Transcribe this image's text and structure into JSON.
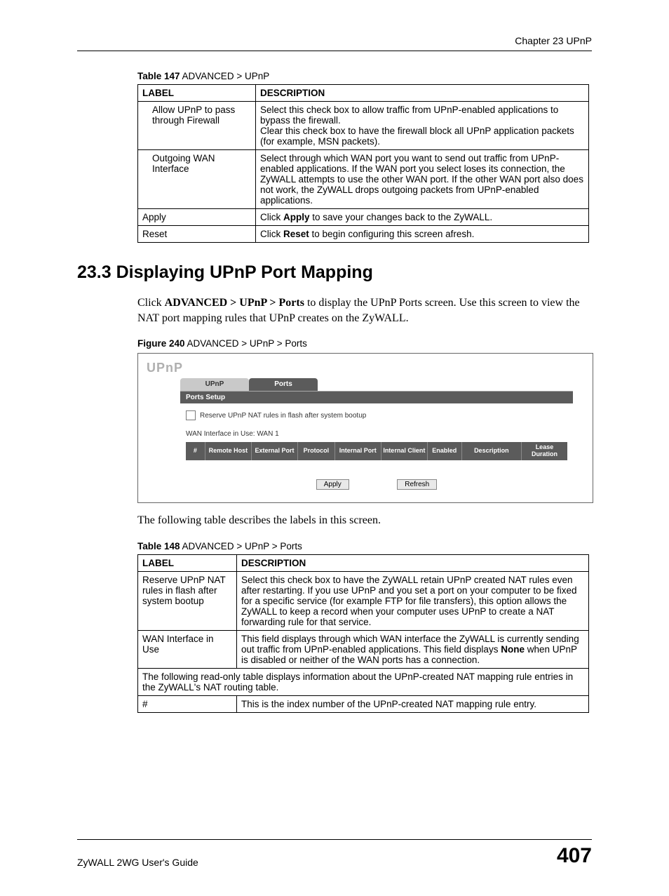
{
  "header": {
    "chapter": "Chapter 23 UPnP"
  },
  "table147": {
    "caption_bold": "Table 147",
    "caption_rest": "   ADVANCED > UPnP",
    "head_label": "LABEL",
    "head_desc": "DESCRIPTION",
    "rows": [
      {
        "label": "Allow UPnP to pass through Firewall",
        "desc": "Select this check box to allow traffic from UPnP-enabled applications to bypass the firewall.\nClear this check box to have the firewall block all UPnP application packets (for example, MSN packets).",
        "indent": true
      },
      {
        "label": "Outgoing WAN Interface",
        "desc": "Select through which WAN port you want to send out traffic from UPnP-enabled applications. If the WAN port you select loses its connection, the ZyWALL attempts to use the other WAN port. If the other WAN port also does not work, the ZyWALL drops outgoing packets from UPnP-enabled applications.",
        "indent": true
      },
      {
        "label": "Apply",
        "desc_pre": "Click ",
        "desc_bold": "Apply",
        "desc_post": " to save your changes back to the ZyWALL.",
        "indent": false
      },
      {
        "label": "Reset",
        "desc_pre": "Click ",
        "desc_bold": "Reset",
        "desc_post": " to begin configuring this screen afresh.",
        "indent": false
      }
    ]
  },
  "section": {
    "heading": "23.3  Displaying UPnP Port Mapping",
    "para1_pre": "Click ",
    "para1_bold": "ADVANCED > UPnP > Ports",
    "para1_post": " to display the UPnP Ports screen. Use this screen to view the NAT port mapping rules that UPnP creates on the ZyWALL."
  },
  "figure": {
    "caption_bold": "Figure 240",
    "caption_rest": "   ADVANCED > UPnP > Ports"
  },
  "ui": {
    "title": "UPnP",
    "tabs": {
      "upnp": "UPnP",
      "ports": "Ports"
    },
    "section_bar": "Ports Setup",
    "checkbox_label": "Reserve UPnP NAT rules in flash after system bootup",
    "wan_line": "WAN Interface in Use: WAN 1",
    "cols": {
      "num": "#",
      "remote_host": "Remote Host",
      "external_port": "External Port",
      "protocol": "Protocol",
      "internal_port": "Internal Port",
      "internal_client": "Internal Client",
      "enabled": "Enabled",
      "description": "Description",
      "lease_duration": "Lease Duration"
    },
    "buttons": {
      "apply": "Apply",
      "refresh": "Refresh"
    }
  },
  "para2": "The following table describes the labels in this screen.",
  "table148": {
    "caption_bold": "Table 148",
    "caption_rest": "   ADVANCED > UPnP > Ports",
    "head_label": "LABEL",
    "head_desc": "DESCRIPTION",
    "row1": {
      "label": "Reserve UPnP NAT rules in flash after system bootup",
      "desc": "Select this check box to have the ZyWALL retain UPnP created NAT rules even after restarting. If you use UPnP and you set a port on your computer to be fixed for a specific service (for example FTP for file transfers), this option allows the ZyWALL to keep a record when your computer uses UPnP to create a NAT forwarding rule for that service."
    },
    "row2": {
      "label": "WAN Interface in Use",
      "desc_pre": "This field displays through which WAN interface the ZyWALL is currently sending out traffic from UPnP-enabled applications. This field displays ",
      "desc_bold": "None",
      "desc_post": " when UPnP is disabled or neither of the WAN ports has a connection."
    },
    "row_span": "The following read-only table displays information about the UPnP-created NAT mapping rule entries in the ZyWALL's NAT routing table.",
    "row4": {
      "label": "#",
      "desc": "This is the index number of the UPnP-created NAT mapping rule entry."
    }
  },
  "footer": {
    "guide": "ZyWALL 2WG User's Guide",
    "page": "407"
  }
}
